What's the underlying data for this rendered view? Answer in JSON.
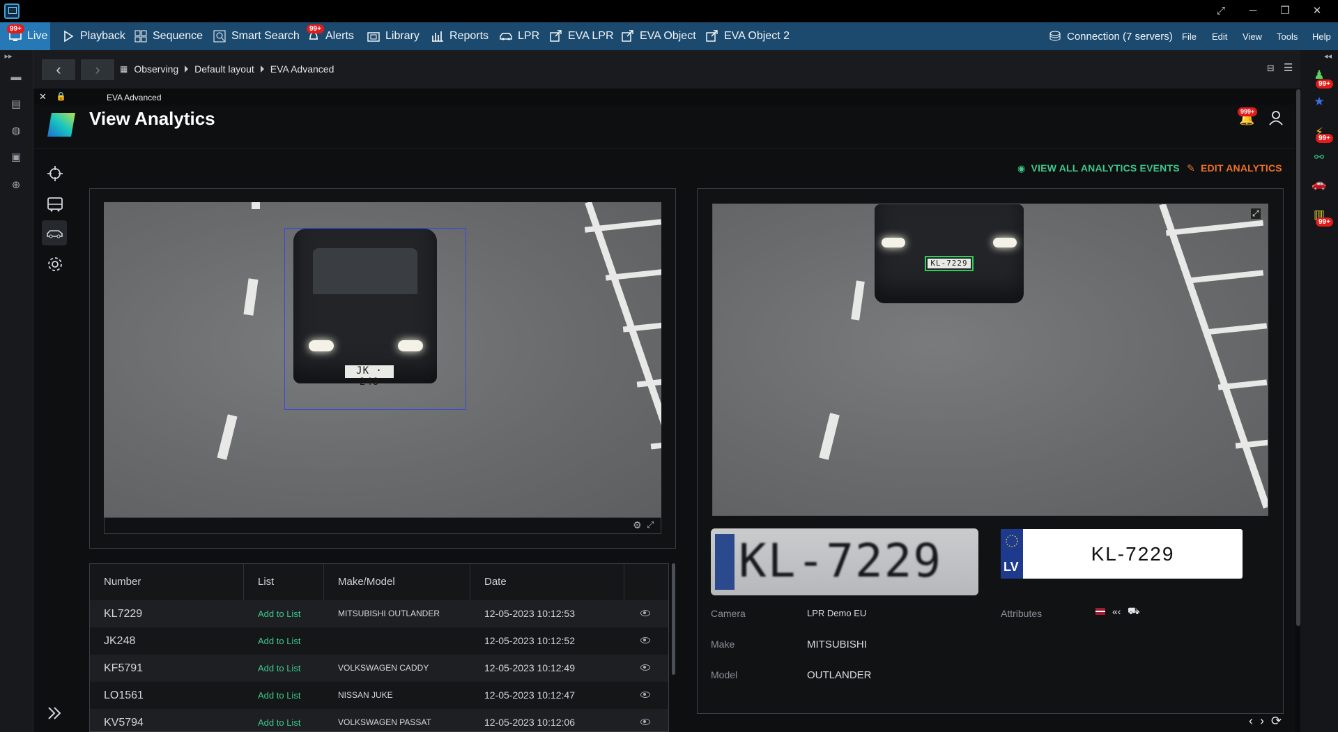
{
  "menubar": {
    "items": [
      {
        "label": "Live",
        "badge": "99+"
      },
      {
        "label": "Playback"
      },
      {
        "label": "Sequence"
      },
      {
        "label": "Smart Search"
      },
      {
        "label": "Alerts",
        "badge": "99+"
      },
      {
        "label": "Library"
      },
      {
        "label": "Reports"
      },
      {
        "label": "LPR"
      },
      {
        "label": "EVA LPR"
      },
      {
        "label": "EVA Object"
      },
      {
        "label": "EVA Object 2"
      }
    ],
    "connection": "Connection (7 servers)",
    "right_menu": [
      "File",
      "Edit",
      "View",
      "Tools",
      "Help"
    ]
  },
  "breadcrumb": [
    "Observing",
    "Default layout",
    "EVA Advanced"
  ],
  "tab": {
    "label": "EVA Advanced"
  },
  "page": {
    "title": "View Analytics",
    "notification_badge": "999+",
    "view_all": "VIEW ALL ANALYTICS EVENTS",
    "edit": "EDIT ANALYTICS"
  },
  "left_camera": {
    "plate_text": "JK · 248"
  },
  "right_camera": {
    "plate_text": "KL-7229"
  },
  "plate": {
    "crop_text": "KL-7229",
    "country_code": "LV",
    "number": "KL-7229"
  },
  "details": {
    "camera_label": "Camera",
    "camera_value": "LPR Demo EU",
    "attributes_label": "Attributes",
    "make_label": "Make",
    "make_value": "MITSUBISHI",
    "model_label": "Model",
    "model_value": "OUTLANDER"
  },
  "table": {
    "headers": [
      "Number",
      "List",
      "Make/Model",
      "Date"
    ],
    "rows": [
      {
        "number": "KL7229",
        "list": "Add to List",
        "make": "MITSUBISHI OUTLANDER",
        "date": "12-05-2023 10:12:53"
      },
      {
        "number": "JK248",
        "list": "Add to List",
        "make": "",
        "date": "12-05-2023 10:12:52"
      },
      {
        "number": "KF5791",
        "list": "Add to List",
        "make": "VOLKSWAGEN CADDY",
        "date": "12-05-2023 10:12:49"
      },
      {
        "number": "LO1561",
        "list": "Add to List",
        "make": "NISSAN JUKE",
        "date": "12-05-2023 10:12:47"
      },
      {
        "number": "KV5794",
        "list": "Add to List",
        "make": "VOLKSWAGEN PASSAT",
        "date": "12-05-2023 10:12:06"
      }
    ]
  },
  "right_rail_badges": [
    "99+",
    "99+",
    "99+"
  ],
  "colors": {
    "menubar": "#1c4a6e",
    "active_tab": "#2679b5",
    "accent_green": "#3ec98e",
    "accent_orange": "#f0702a",
    "badge": "#e21b1b"
  }
}
